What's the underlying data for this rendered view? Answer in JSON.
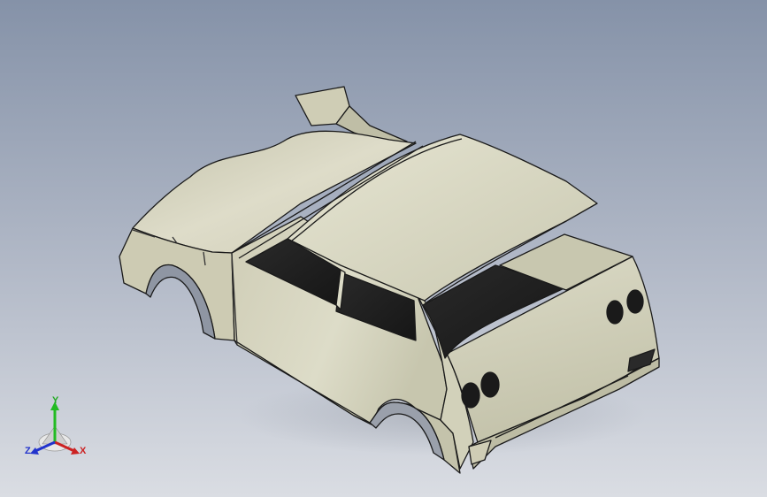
{
  "viewport": {
    "background_top": "#8592a8",
    "background_bottom": "#d7dbe2",
    "model": "car-body-shell",
    "body_color": "#d9d8c4"
  },
  "triad": {
    "y_label": "Y",
    "z_label": "Z",
    "x_label": "X",
    "y_color": "#22bb22",
    "z_color": "#2233cc",
    "x_color": "#cc2222"
  }
}
